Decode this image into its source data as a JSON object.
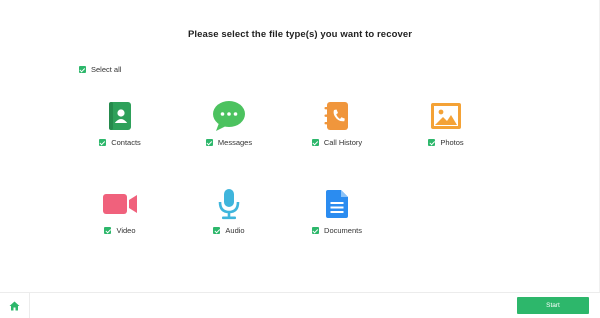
{
  "title": "Please select the file type(s) you want to recover",
  "select_all": {
    "label": "Select all",
    "checked": true
  },
  "file_types": [
    {
      "label": "Contacts",
      "icon": "contacts-icon",
      "color": "#2ea05a",
      "checked": true
    },
    {
      "label": "Messages",
      "icon": "messages-icon",
      "color": "#4cc25f",
      "checked": true
    },
    {
      "label": "Call History",
      "icon": "call-history-icon",
      "color": "#f0963c",
      "checked": true
    },
    {
      "label": "Photos",
      "icon": "photos-icon",
      "color": "#f4a236",
      "checked": true
    },
    {
      "label": "Video",
      "icon": "video-icon",
      "color": "#f0617c",
      "checked": true
    },
    {
      "label": "Audio",
      "icon": "audio-icon",
      "color": "#3fb5dc",
      "checked": true
    },
    {
      "label": "Documents",
      "icon": "documents-icon",
      "color": "#2b8cf0",
      "checked": true
    }
  ],
  "footer": {
    "home_icon": "home-icon",
    "start_label": "Start"
  },
  "accent": "#2db76b"
}
